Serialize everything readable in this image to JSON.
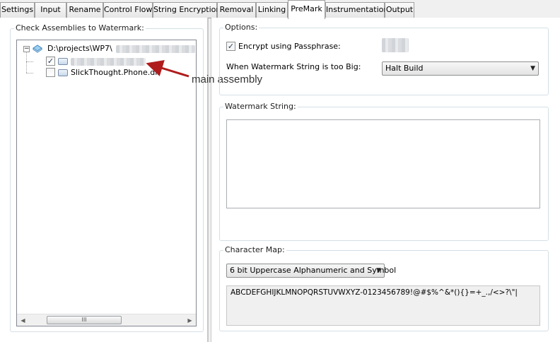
{
  "tabs": [
    {
      "label": "Settings",
      "active": false
    },
    {
      "label": "Input",
      "active": false
    },
    {
      "label": "Rename",
      "active": false
    },
    {
      "label": "Control Flow",
      "active": false
    },
    {
      "label": "String Encryption",
      "active": false
    },
    {
      "label": "Removal",
      "active": false
    },
    {
      "label": "Linking",
      "active": false
    },
    {
      "label": "PreMark",
      "active": true
    },
    {
      "label": "Instrumentation",
      "active": false
    },
    {
      "label": "Output",
      "active": false
    }
  ],
  "left": {
    "group_title": "Check Assemblies to Watermark:",
    "tree": {
      "root_label": "D:\\projects\\WP7\\",
      "children": [
        {
          "label": "",
          "checked": true
        },
        {
          "label": "SlickThought.Phone.dll",
          "checked": false
        }
      ]
    },
    "scroll_thumb_glyph": "III"
  },
  "annotation": {
    "text": "main assembly",
    "color": "#b01c1c"
  },
  "options": {
    "group_title": "Options:",
    "encrypt_label": "Encrypt using Passphrase:",
    "encrypt_checked": true,
    "too_big_label": "When Watermark String is too Big:",
    "too_big_value": "Halt Build"
  },
  "watermark": {
    "group_title": "Watermark String:",
    "value": ""
  },
  "charmap": {
    "group_title": "Character Map:",
    "selected": "6 bit Uppercase Alphanumeric and Symbol",
    "characters": "ABCDEFGHIJKLMNOPQRSTUVWXYZ-0123456789!@#$%^&*(){}=+_.,/<>?\\\"|"
  },
  "icons": {
    "checkmark": "✓",
    "dropdown": "▼",
    "scroll_left": "◀",
    "scroll_right": "▶",
    "collapse": "−"
  }
}
